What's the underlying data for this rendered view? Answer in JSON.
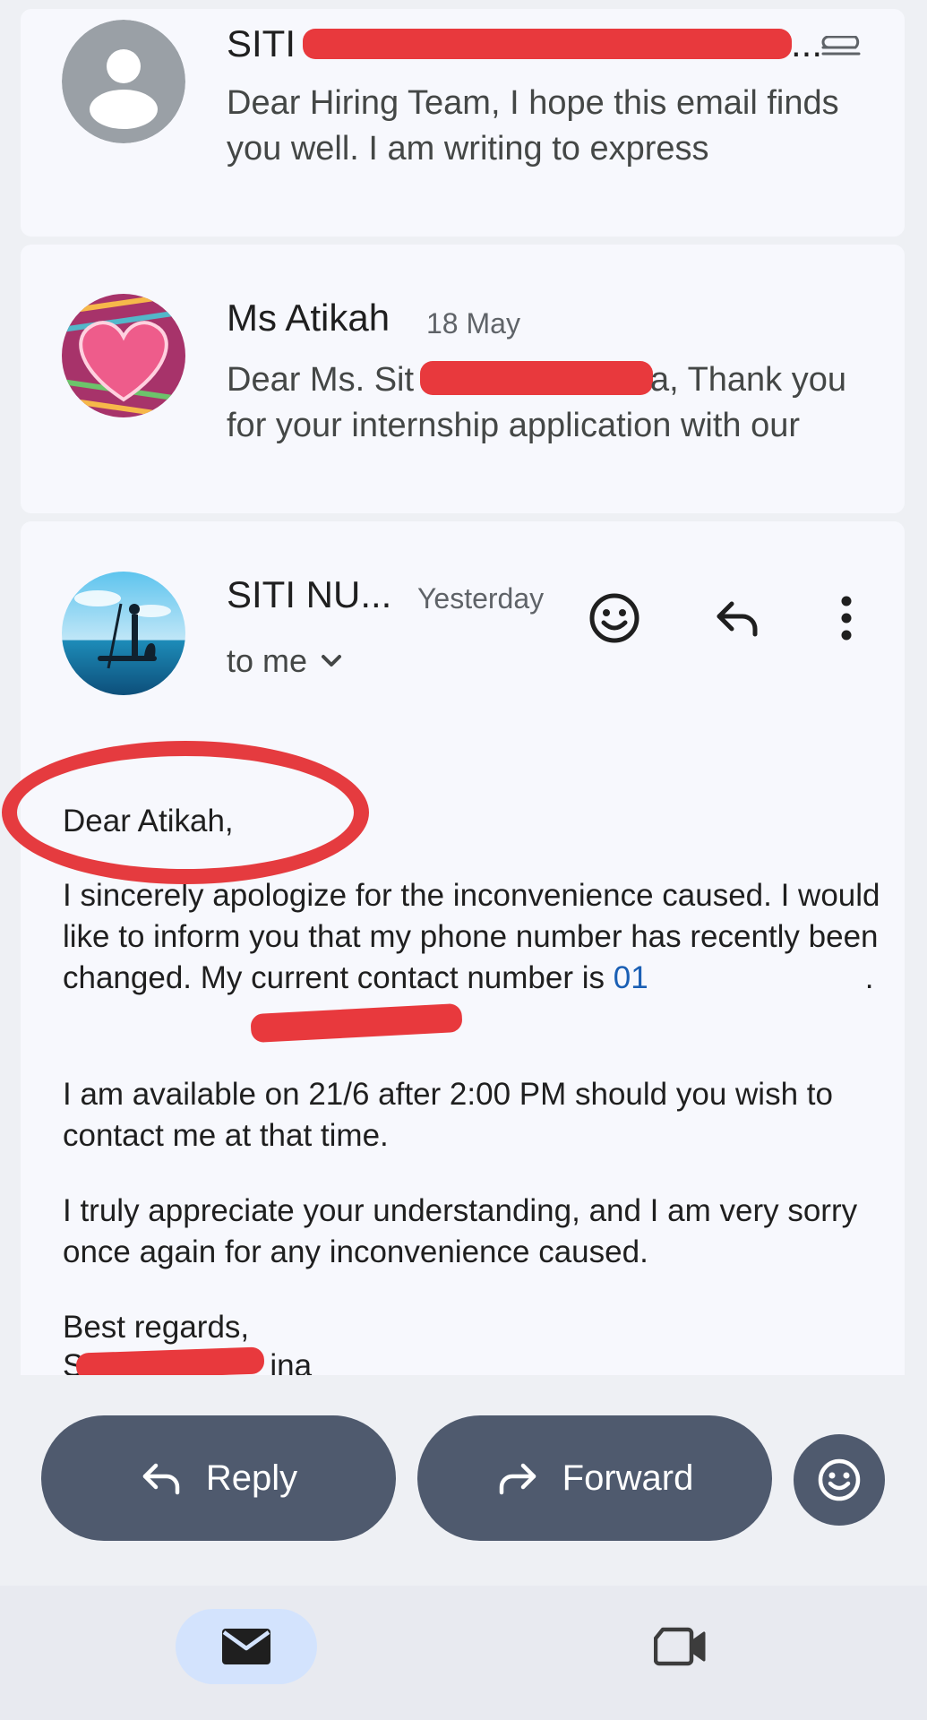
{
  "thread": {
    "messages": [
      {
        "sender": "SITI",
        "sender_suffix": "...",
        "snippet": "Dear Hiring Team, I hope this email finds you well. I am writing to express",
        "has_attachment": true,
        "avatar": "person-icon"
      },
      {
        "sender": "Ms Atikah",
        "date": "18 May",
        "snippet_start": "Dear Ms. Sit",
        "snippet_mid": "a, Thank you",
        "snippet_end": "for your internship application with our",
        "avatar": "heart-pattern"
      }
    ],
    "open_message": {
      "sender": "SITI NU...",
      "date": "Yesterday",
      "recipient": "to me",
      "avatar": "paddleboard-photo",
      "greeting": "Dear Atikah,",
      "paragraph1_before_link": "I sincerely apologize for the inconvenience caused. I would like to inform you that my phone number has recently been changed. My current contact number is ",
      "phone_link_visible": "01",
      "paragraph1_end": ".",
      "paragraph2": "I am available on 21/6 after 2:00 PM should you wish to contact me at that time.",
      "paragraph3": "I truly appreciate your understanding, and I am very sorry once again for any inconvenience caused.",
      "closing": "Best regards,",
      "signature_start": "S",
      "signature_end": "ina"
    }
  },
  "actions": {
    "reply_label": "Reply",
    "forward_label": "Forward"
  },
  "bottom_nav": {
    "items": [
      "mail-icon",
      "video-camera-icon"
    ],
    "active": "mail-icon"
  },
  "colors": {
    "card_bg": "#f7f8fd",
    "pill_bg": "#4f5a6e",
    "redaction": "#e8393d",
    "link": "#1a5fb4",
    "nav_active": "#d3e3fd"
  }
}
